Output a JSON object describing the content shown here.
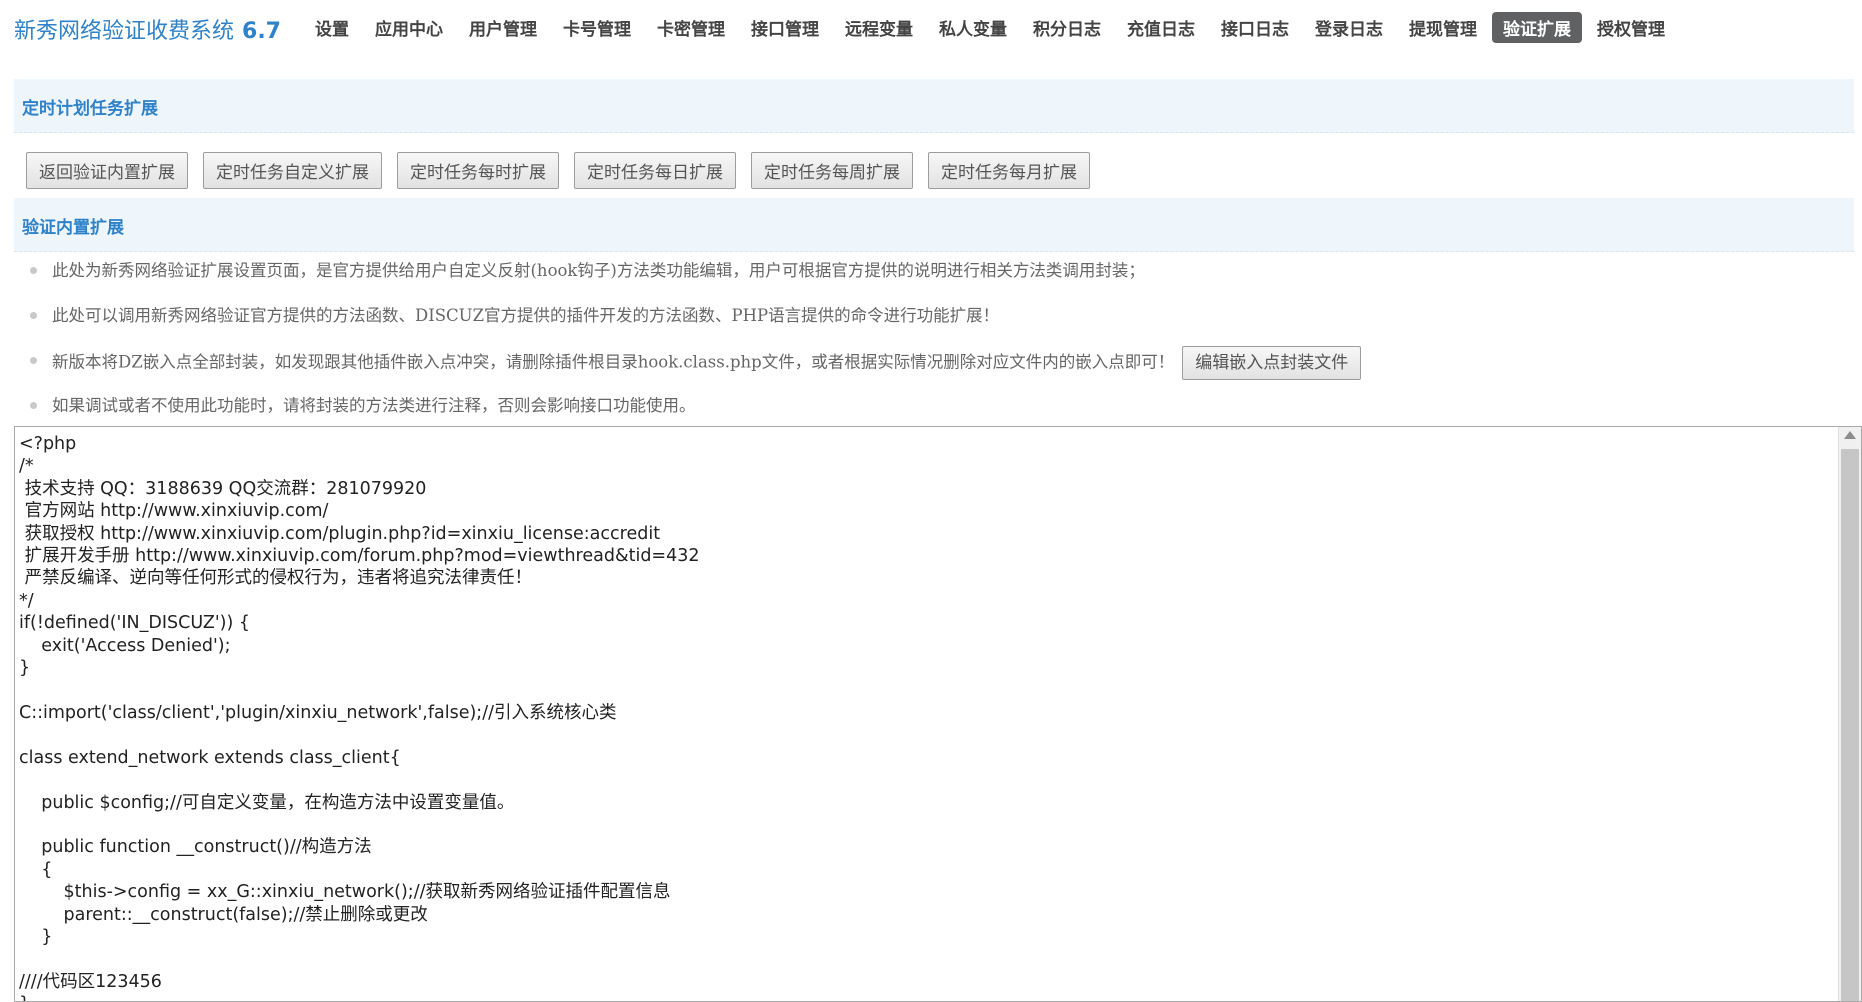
{
  "brand": {
    "name": "新秀网络验证收费系统",
    "version": "6.7"
  },
  "nav": {
    "items": [
      {
        "label": "设置"
      },
      {
        "label": "应用中心"
      },
      {
        "label": "用户管理"
      },
      {
        "label": "卡号管理"
      },
      {
        "label": "卡密管理"
      },
      {
        "label": "接口管理"
      },
      {
        "label": "远程变量"
      },
      {
        "label": "私人变量"
      },
      {
        "label": "积分日志"
      },
      {
        "label": "充值日志"
      },
      {
        "label": "接口日志"
      },
      {
        "label": "登录日志"
      },
      {
        "label": "提现管理"
      },
      {
        "label": "验证扩展",
        "active": true
      },
      {
        "label": "授权管理"
      }
    ]
  },
  "cron_section": {
    "title": "定时计划任务扩展"
  },
  "buttons": [
    {
      "label": "返回验证内置扩展"
    },
    {
      "label": "定时任务自定义扩展"
    },
    {
      "label": "定时任务每时扩展"
    },
    {
      "label": "定时任务每日扩展"
    },
    {
      "label": "定时任务每周扩展"
    },
    {
      "label": "定时任务每月扩展"
    }
  ],
  "builtin_section": {
    "title": "验证内置扩展"
  },
  "notes": [
    "此处为新秀网络验证扩展设置页面，是官方提供给用户自定义反射(hook钩子)方法类功能编辑，用户可根据官方提供的说明进行相关方法类调用封装；",
    "此处可以调用新秀网络验证官方提供的方法函数、DISCUZ官方提供的插件开发的方法函数、PHP语言提供的命令进行功能扩展！",
    "新版本将DZ嵌入点全部封装，如发现跟其他插件嵌入点冲突，请删除插件根目录hook.class.php文件，或者根据实际情况删除对应文件内的嵌入点即可！",
    "如果调试或者不使用此功能时，请将封装的方法类进行注释，否则会影响接口功能使用。"
  ],
  "edit_hook_button": {
    "label": "编辑嵌入点封装文件"
  },
  "editor": {
    "code": "<?php\n/*\n 技术支持 QQ：3188639 QQ交流群：281079920\n 官方网站 http://www.xinxiuvip.com/\n 获取授权 http://www.xinxiuvip.com/plugin.php?id=xinxiu_license:accredit\n 扩展开发手册 http://www.xinxiuvip.com/forum.php?mod=viewthread&tid=432\n 严禁反编译、逆向等任何形式的侵权行为，违者将追究法律责任！\n*/\nif(!defined('IN_DISCUZ')) {\n    exit('Access Denied');\n}\n\nC::import('class/client','plugin/xinxiu_network',false);//引入系统核心类\n\nclass extend_network extends class_client{\n\n    public $config;//可自定义变量，在构造方法中设置变量值。\n\n    public function __construct()//构造方法\n    {\n        $this->config = xx_G::xinxiu_network();//获取新秀网络验证插件配置信息\n        parent::__construct(false);//禁止删除或更改\n    }\n\n////代码区123456\n}"
  }
}
